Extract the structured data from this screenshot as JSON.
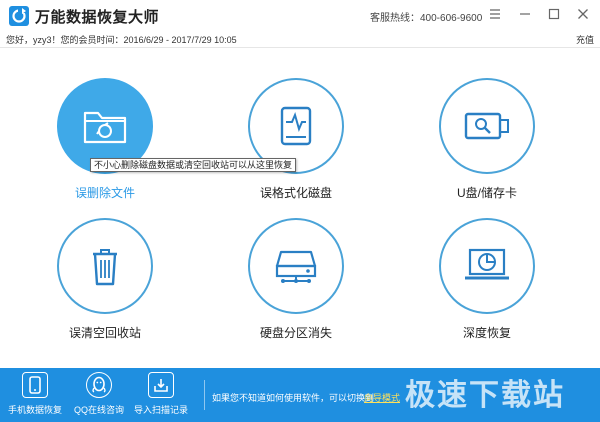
{
  "window": {
    "title": "万能数据恢复大师",
    "hotline": "客服热线：400-606-9600",
    "controls": [
      "settings-icon",
      "minimize-icon",
      "maximize-icon",
      "close-icon"
    ]
  },
  "member_bar": {
    "text": "您好，yzy3！您的会员时间：2016/6/29 - 2017/7/29 10:05",
    "recharge_label": "充值"
  },
  "features": [
    {
      "label": "误删除文件",
      "icon": "folder-recycle-icon",
      "active": true
    },
    {
      "label": "误格式化磁盘",
      "icon": "disk-pulse-icon",
      "active": false
    },
    {
      "label": "U盘/储存卡",
      "icon": "usb-drive-icon",
      "active": false
    },
    {
      "label": "误清空回收站",
      "icon": "trash-bin-icon",
      "active": false
    },
    {
      "label": "硬盘分区消失",
      "icon": "hard-drive-network-icon",
      "active": false
    },
    {
      "label": "深度恢复",
      "icon": "laptop-disk-icon",
      "active": false
    }
  ],
  "tooltip": "不小心删除磁盘数据或清空回收站可以从这里恢复",
  "bottom": {
    "items": [
      {
        "label": "手机数据恢复",
        "icon": "phone-icon"
      },
      {
        "label": "QQ在线咨询",
        "icon": "qq-penguin-icon"
      },
      {
        "label": "导入扫描记录",
        "icon": "import-icon"
      }
    ],
    "hint": "如果您不知道如何使用软件，可以切换到",
    "guide_link": "向导模式",
    "watermark": "极速下载站"
  },
  "colors": {
    "accent": "#3fa9e8",
    "circle_border": "#4aa3d8",
    "bottom_bar": "#1f8fe0",
    "link": "#ffe15a"
  }
}
